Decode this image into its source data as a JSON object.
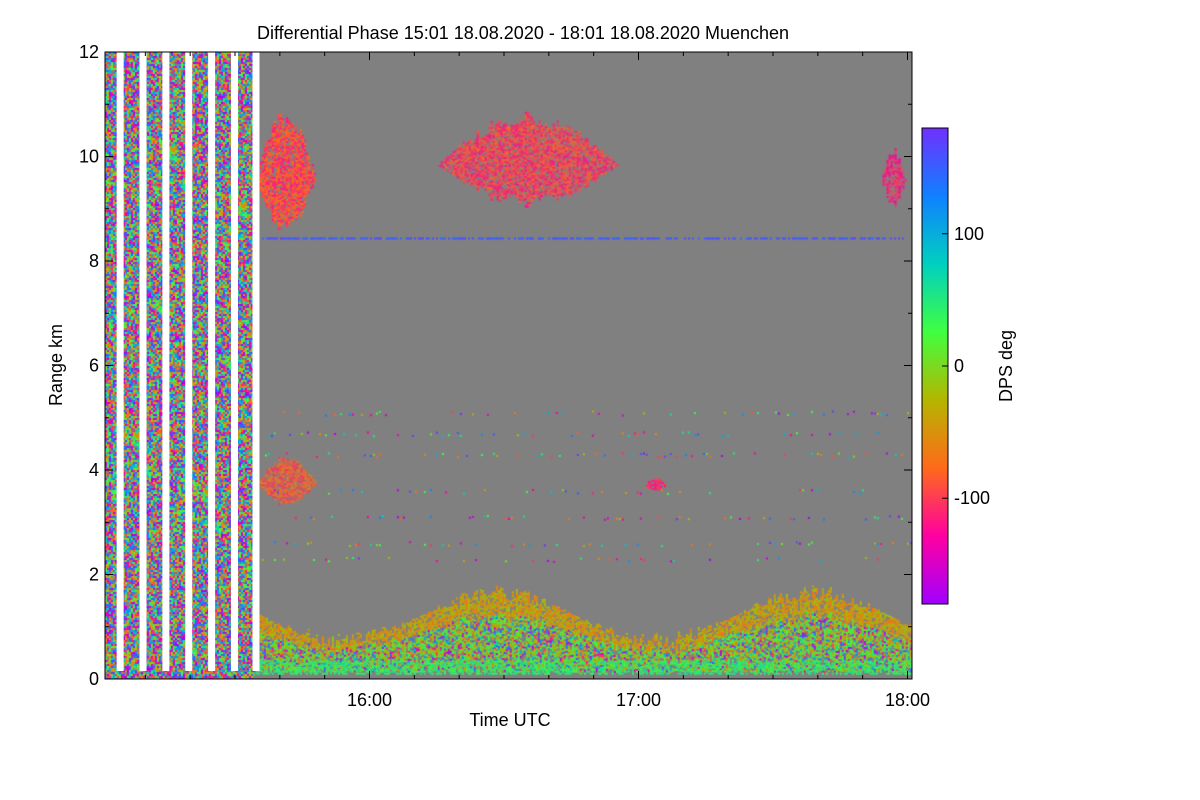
{
  "chart_data": {
    "type": "heatmap",
    "title": "Differential Phase   15:01 18.08.2020 - 18:01 18.08.2020 Muenchen",
    "xlabel": "Time UTC",
    "ylabel": "Range km",
    "x_ticks": [
      {
        "value": 16.0,
        "label": "16:00"
      },
      {
        "value": 17.0,
        "label": "17:00"
      },
      {
        "value": 18.0,
        "label": "18:00"
      }
    ],
    "y_ticks": [
      0,
      2,
      4,
      6,
      8,
      10,
      12
    ],
    "xlim_hours": [
      15.0167,
      18.0167
    ],
    "ylim_km": [
      0,
      12
    ],
    "background_color": "#808080",
    "colorbar": {
      "label": "DPS deg",
      "range": [
        -180,
        180
      ],
      "ticks": [
        100,
        0,
        -100
      ],
      "colormap": [
        "#a000ff",
        "#ff00a0",
        "#ff6a1a",
        "#b5b500",
        "#40ff40",
        "#00d0c0",
        "#1080ff",
        "#7030ff"
      ]
    },
    "data_gaps_start_hours": [
      15.06,
      15.145,
      15.23,
      15.315,
      15.4,
      15.485,
      15.565
    ],
    "features": [
      {
        "name": "boundary-layer noise",
        "range_km": [
          0.1,
          1.9
        ],
        "time_hours": [
          15.55,
          18.0167
        ],
        "phase_deg": "mixed"
      },
      {
        "name": "cirrus cloud 1",
        "range_km": [
          8.4,
          10.8
        ],
        "time_hours": [
          15.58,
          15.8
        ],
        "phase_deg": -100
      },
      {
        "name": "cirrus cloud 2",
        "range_km": [
          8.9,
          10.8
        ],
        "time_hours": [
          16.25,
          16.92
        ],
        "phase_deg": -100
      },
      {
        "name": "cirrus cloud 3",
        "range_km": [
          9.0,
          10.1
        ],
        "time_hours": [
          17.92,
          17.99
        ],
        "phase_deg": -110
      },
      {
        "name": "mid-level cloud",
        "range_km": [
          3.3,
          4.2
        ],
        "time_hours": [
          15.58,
          15.8
        ],
        "phase_deg": -90
      },
      {
        "name": "small echo",
        "range_km": [
          3.6,
          3.8
        ],
        "time_hours": [
          17.03,
          17.1
        ],
        "phase_deg": -110
      },
      {
        "name": "horizontal line",
        "range_km": [
          8.4,
          8.5
        ],
        "time_hours": [
          15.58,
          17.98
        ],
        "phase_deg": 150
      }
    ]
  }
}
